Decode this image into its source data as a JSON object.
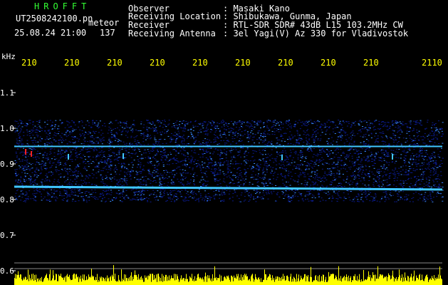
{
  "header": {
    "app_name": "HROFFT",
    "file_name": "UT2508242100.pn",
    "mode": "meteor",
    "datetime": "25.08.24 21:00",
    "count": "137"
  },
  "info": [
    {
      "label": "Observer",
      "value": ": Masaki Kano"
    },
    {
      "label": "Receiving Location",
      "value": ": Shibukawa, Gunma, Japan"
    },
    {
      "label": "Receiver",
      "value": ": RTL-SDR SDR# 43dB L15 103.2MHz CW"
    },
    {
      "label": "Receiving Antenna",
      "value": ": 3el Yagi(V) Az 330 for Vladivostok"
    }
  ],
  "freq_axis": {
    "unit": "kHz",
    "ticks": [
      "1.1",
      "1.0",
      "0.9",
      "0.8",
      "0.7",
      "0.6"
    ]
  },
  "time_axis": {
    "ticks": [
      "210",
      "210",
      "210",
      "210",
      "210",
      "210",
      "210",
      "210",
      "210",
      "2110"
    ]
  },
  "colors": {
    "background": "#000000",
    "noise_dark": "#0a1a8a",
    "noise_bright": "#3a8cff",
    "carrier": "#40c8ff",
    "ping": "#ff2020",
    "bottom_bars": "#ffff00"
  }
}
